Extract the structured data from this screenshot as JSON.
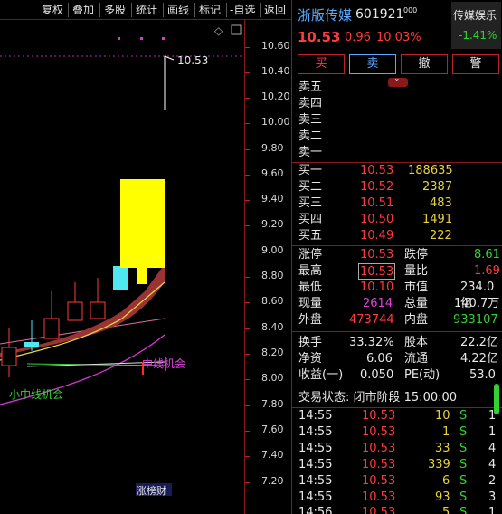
{
  "toolbar": {
    "items": [
      "复权",
      "叠加",
      "多股",
      "统计",
      "画线",
      "标记",
      "-自选",
      "返回"
    ]
  },
  "chart": {
    "price_ticks": [
      "10.60",
      "10.40",
      "10.20",
      "10.00",
      "9.80",
      "9.60",
      "9.40",
      "9.20",
      "9.00",
      "8.80",
      "8.60",
      "8.40",
      "8.20",
      "8.00",
      "7.80",
      "7.60",
      "7.40",
      "7.20"
    ],
    "high_marker": "10.53",
    "annotation_middle": "中线机会",
    "annotation_small": "小中线机会",
    "footer_badge": "涨榜财"
  },
  "stock": {
    "name": "浙版传媒",
    "code": "601921",
    "code_suffix": "000",
    "sector": "传媒娱乐",
    "sector_change": "-1.41%",
    "price": "10.53",
    "change": "0.96",
    "change_pct": "10.03%"
  },
  "actions": [
    "买",
    "卖",
    "撤",
    "警"
  ],
  "sell_book": [
    "卖五",
    "卖四",
    "卖三",
    "卖二",
    "卖一"
  ],
  "buy_book": [
    {
      "label": "买一",
      "price": "10.53",
      "vol": "188635"
    },
    {
      "label": "买二",
      "price": "10.52",
      "vol": "2387"
    },
    {
      "label": "买三",
      "price": "10.51",
      "vol": "483"
    },
    {
      "label": "买四",
      "price": "10.50",
      "vol": "1491"
    },
    {
      "label": "买五",
      "price": "10.49",
      "vol": "222"
    }
  ],
  "stats": {
    "limit_up_label": "涨停",
    "limit_up": "10.53",
    "limit_down_label": "跌停",
    "limit_down": "8.61",
    "high_label": "最高",
    "high": "10.53",
    "vol_ratio_label": "量比",
    "vol_ratio": "1.69",
    "low_label": "最低",
    "low": "10.10",
    "mcap_label": "市值",
    "mcap": "234.0亿",
    "now_vol_label": "现量",
    "now_vol": "2614",
    "total_vol_label": "总量",
    "total_vol": "140.7万",
    "outer_label": "外盘",
    "outer": "473744",
    "inner_label": "内盘",
    "inner": "933107"
  },
  "fund": {
    "turnover_label": "换手",
    "turnover": "33.32%",
    "equity_label": "股本",
    "equity": "22.2亿",
    "nav_label": "净资",
    "nav": "6.06",
    "float_label": "流通",
    "float": "4.22亿",
    "eps_label": "收益(一)",
    "eps": "0.050",
    "pe_label": "PE(动)",
    "pe": "53.0"
  },
  "status": "交易状态: 闭市阶段 15:00:00",
  "ticks": [
    {
      "time": "14:55",
      "price": "10.53",
      "vol": "10",
      "side": "S",
      "n": "1"
    },
    {
      "time": "14:55",
      "price": "10.53",
      "vol": "1",
      "side": "S",
      "n": "1"
    },
    {
      "time": "14:55",
      "price": "10.53",
      "vol": "33",
      "side": "S",
      "n": "4"
    },
    {
      "time": "14:55",
      "price": "10.53",
      "vol": "339",
      "side": "S",
      "n": "4"
    },
    {
      "time": "14:55",
      "price": "10.53",
      "vol": "6",
      "side": "S",
      "n": "2"
    },
    {
      "time": "14:55",
      "price": "10.53",
      "vol": "93",
      "side": "S",
      "n": "3"
    },
    {
      "time": "14:56",
      "price": "10.53",
      "vol": "5",
      "side": "S",
      "n": "1"
    }
  ]
}
